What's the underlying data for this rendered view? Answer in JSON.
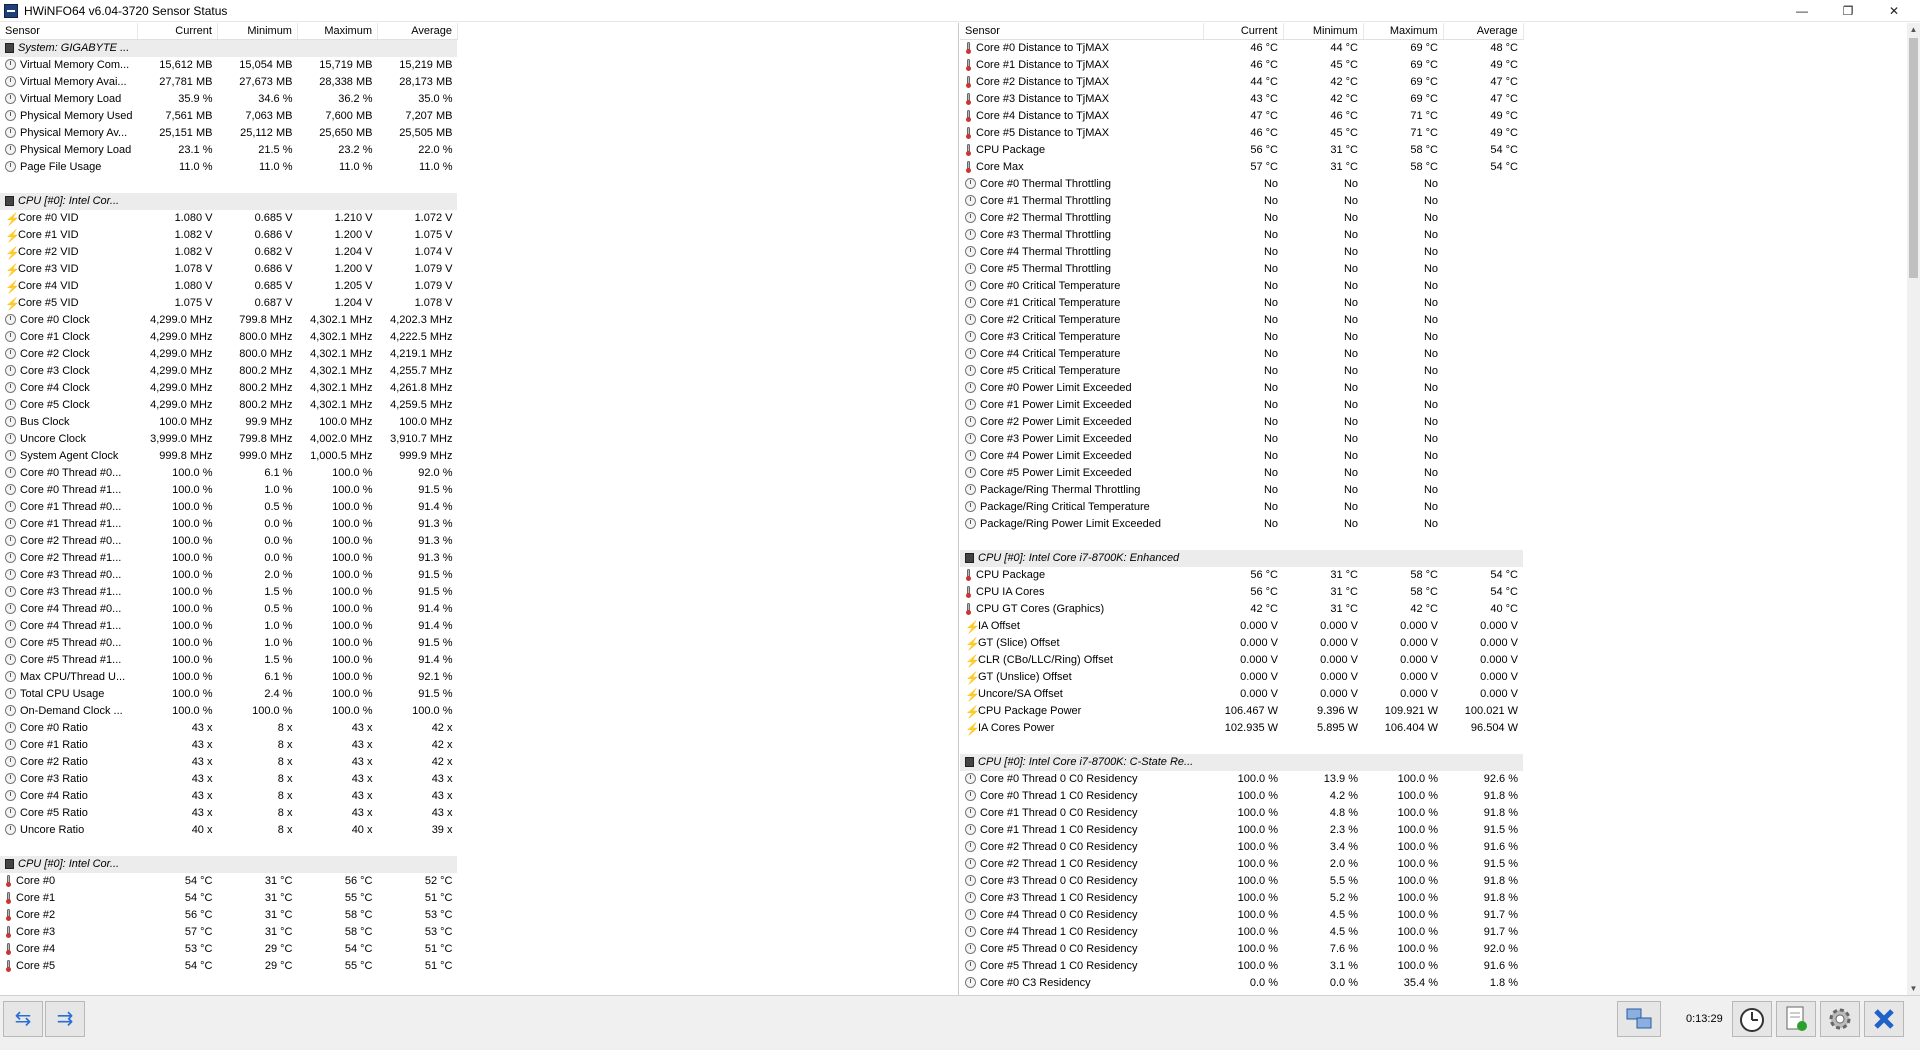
{
  "window": {
    "title": "HWiNFO64 v6.04-3720 Sensor Status",
    "minimize": "—",
    "restore": "❐",
    "close": "✕"
  },
  "columns": {
    "sensor": "Sensor",
    "current": "Current",
    "minimum": "Minimum",
    "maximum": "Maximum",
    "average": "Average"
  },
  "left_rows": [
    {
      "t": "group",
      "n": "System: GIGABYTE ..."
    },
    {
      "i": "clock",
      "n": "Virtual Memory Com...",
      "c": "15,612 MB",
      "mn": "15,054 MB",
      "mx": "15,719 MB",
      "a": "15,219 MB"
    },
    {
      "i": "clock",
      "n": "Virtual Memory Avai...",
      "c": "27,781 MB",
      "mn": "27,673 MB",
      "mx": "28,338 MB",
      "a": "28,173 MB"
    },
    {
      "i": "clock",
      "n": "Virtual Memory Load",
      "c": "35.9 %",
      "mn": "34.6 %",
      "mx": "36.2 %",
      "a": "35.0 %"
    },
    {
      "i": "clock",
      "n": "Physical Memory Used",
      "c": "7,561 MB",
      "mn": "7,063 MB",
      "mx": "7,600 MB",
      "a": "7,207 MB"
    },
    {
      "i": "clock",
      "n": "Physical Memory Av...",
      "c": "25,151 MB",
      "mn": "25,112 MB",
      "mx": "25,650 MB",
      "a": "25,505 MB"
    },
    {
      "i": "clock",
      "n": "Physical Memory Load",
      "c": "23.1 %",
      "mn": "21.5 %",
      "mx": "23.2 %",
      "a": "22.0 %"
    },
    {
      "i": "clock",
      "n": "Page File Usage",
      "c": "11.0 %",
      "mn": "11.0 %",
      "mx": "11.0 %",
      "a": "11.0 %"
    },
    {
      "t": "blank"
    },
    {
      "t": "group",
      "n": "CPU [#0]: Intel Cor..."
    },
    {
      "i": "bolt",
      "n": "Core #0 VID",
      "c": "1.080 V",
      "mn": "0.685 V",
      "mx": "1.210 V",
      "a": "1.072 V"
    },
    {
      "i": "bolt",
      "n": "Core #1 VID",
      "c": "1.082 V",
      "mn": "0.686 V",
      "mx": "1.200 V",
      "a": "1.075 V"
    },
    {
      "i": "bolt",
      "n": "Core #2 VID",
      "c": "1.082 V",
      "mn": "0.682 V",
      "mx": "1.204 V",
      "a": "1.074 V"
    },
    {
      "i": "bolt",
      "n": "Core #3 VID",
      "c": "1.078 V",
      "mn": "0.686 V",
      "mx": "1.200 V",
      "a": "1.079 V"
    },
    {
      "i": "bolt",
      "n": "Core #4 VID",
      "c": "1.080 V",
      "mn": "0.685 V",
      "mx": "1.205 V",
      "a": "1.079 V"
    },
    {
      "i": "bolt",
      "n": "Core #5 VID",
      "c": "1.075 V",
      "mn": "0.687 V",
      "mx": "1.204 V",
      "a": "1.078 V"
    },
    {
      "i": "clock",
      "n": "Core #0 Clock",
      "c": "4,299.0 MHz",
      "mn": "799.8 MHz",
      "mx": "4,302.1 MHz",
      "a": "4,202.3 MHz"
    },
    {
      "i": "clock",
      "n": "Core #1 Clock",
      "c": "4,299.0 MHz",
      "mn": "800.0 MHz",
      "mx": "4,302.1 MHz",
      "a": "4,222.5 MHz"
    },
    {
      "i": "clock",
      "n": "Core #2 Clock",
      "c": "4,299.0 MHz",
      "mn": "800.0 MHz",
      "mx": "4,302.1 MHz",
      "a": "4,219.1 MHz"
    },
    {
      "i": "clock",
      "n": "Core #3 Clock",
      "c": "4,299.0 MHz",
      "mn": "800.2 MHz",
      "mx": "4,302.1 MHz",
      "a": "4,255.7 MHz"
    },
    {
      "i": "clock",
      "n": "Core #4 Clock",
      "c": "4,299.0 MHz",
      "mn": "800.2 MHz",
      "mx": "4,302.1 MHz",
      "a": "4,261.8 MHz"
    },
    {
      "i": "clock",
      "n": "Core #5 Clock",
      "c": "4,299.0 MHz",
      "mn": "800.2 MHz",
      "mx": "4,302.1 MHz",
      "a": "4,259.5 MHz"
    },
    {
      "i": "clock",
      "n": "Bus Clock",
      "c": "100.0 MHz",
      "mn": "99.9 MHz",
      "mx": "100.0 MHz",
      "a": "100.0 MHz"
    },
    {
      "i": "clock",
      "n": "Uncore Clock",
      "c": "3,999.0 MHz",
      "mn": "799.8 MHz",
      "mx": "4,002.0 MHz",
      "a": "3,910.7 MHz"
    },
    {
      "i": "clock",
      "n": "System Agent Clock",
      "c": "999.8 MHz",
      "mn": "999.0 MHz",
      "mx": "1,000.5 MHz",
      "a": "999.9 MHz"
    },
    {
      "i": "clock",
      "n": "Core #0 Thread #0...",
      "c": "100.0 %",
      "mn": "6.1 %",
      "mx": "100.0 %",
      "a": "92.0 %"
    },
    {
      "i": "clock",
      "n": "Core #0 Thread #1...",
      "c": "100.0 %",
      "mn": "1.0 %",
      "mx": "100.0 %",
      "a": "91.5 %"
    },
    {
      "i": "clock",
      "n": "Core #1 Thread #0...",
      "c": "100.0 %",
      "mn": "0.5 %",
      "mx": "100.0 %",
      "a": "91.4 %"
    },
    {
      "i": "clock",
      "n": "Core #1 Thread #1...",
      "c": "100.0 %",
      "mn": "0.0 %",
      "mx": "100.0 %",
      "a": "91.3 %"
    },
    {
      "i": "clock",
      "n": "Core #2 Thread #0...",
      "c": "100.0 %",
      "mn": "0.0 %",
      "mx": "100.0 %",
      "a": "91.3 %"
    },
    {
      "i": "clock",
      "n": "Core #2 Thread #1...",
      "c": "100.0 %",
      "mn": "0.0 %",
      "mx": "100.0 %",
      "a": "91.3 %"
    },
    {
      "i": "clock",
      "n": "Core #3 Thread #0...",
      "c": "100.0 %",
      "mn": "2.0 %",
      "mx": "100.0 %",
      "a": "91.5 %"
    },
    {
      "i": "clock",
      "n": "Core #3 Thread #1...",
      "c": "100.0 %",
      "mn": "1.5 %",
      "mx": "100.0 %",
      "a": "91.5 %"
    },
    {
      "i": "clock",
      "n": "Core #4 Thread #0...",
      "c": "100.0 %",
      "mn": "0.5 %",
      "mx": "100.0 %",
      "a": "91.4 %"
    },
    {
      "i": "clock",
      "n": "Core #4 Thread #1...",
      "c": "100.0 %",
      "mn": "1.0 %",
      "mx": "100.0 %",
      "a": "91.4 %"
    },
    {
      "i": "clock",
      "n": "Core #5 Thread #0...",
      "c": "100.0 %",
      "mn": "1.0 %",
      "mx": "100.0 %",
      "a": "91.5 %"
    },
    {
      "i": "clock",
      "n": "Core #5 Thread #1...",
      "c": "100.0 %",
      "mn": "1.5 %",
      "mx": "100.0 %",
      "a": "91.4 %"
    },
    {
      "i": "clock",
      "n": "Max CPU/Thread U...",
      "c": "100.0 %",
      "mn": "6.1 %",
      "mx": "100.0 %",
      "a": "92.1 %"
    },
    {
      "i": "clock",
      "n": "Total CPU Usage",
      "c": "100.0 %",
      "mn": "2.4 %",
      "mx": "100.0 %",
      "a": "91.5 %"
    },
    {
      "i": "clock",
      "n": "On-Demand Clock ...",
      "c": "100.0 %",
      "mn": "100.0 %",
      "mx": "100.0 %",
      "a": "100.0 %"
    },
    {
      "i": "clock",
      "n": "Core #0 Ratio",
      "c": "43 x",
      "mn": "8 x",
      "mx": "43 x",
      "a": "42 x"
    },
    {
      "i": "clock",
      "n": "Core #1 Ratio",
      "c": "43 x",
      "mn": "8 x",
      "mx": "43 x",
      "a": "42 x"
    },
    {
      "i": "clock",
      "n": "Core #2 Ratio",
      "c": "43 x",
      "mn": "8 x",
      "mx": "43 x",
      "a": "42 x"
    },
    {
      "i": "clock",
      "n": "Core #3 Ratio",
      "c": "43 x",
      "mn": "8 x",
      "mx": "43 x",
      "a": "43 x"
    },
    {
      "i": "clock",
      "n": "Core #4 Ratio",
      "c": "43 x",
      "mn": "8 x",
      "mx": "43 x",
      "a": "43 x"
    },
    {
      "i": "clock",
      "n": "Core #5 Ratio",
      "c": "43 x",
      "mn": "8 x",
      "mx": "43 x",
      "a": "43 x"
    },
    {
      "i": "clock",
      "n": "Uncore Ratio",
      "c": "40 x",
      "mn": "8 x",
      "mx": "40 x",
      "a": "39 x"
    },
    {
      "t": "blank"
    },
    {
      "t": "group",
      "n": "CPU [#0]: Intel Cor..."
    },
    {
      "i": "therm",
      "n": "Core #0",
      "c": "54 °C",
      "mn": "31 °C",
      "mx": "56 °C",
      "a": "52 °C"
    },
    {
      "i": "therm",
      "n": "Core #1",
      "c": "54 °C",
      "mn": "31 °C",
      "mx": "55 °C",
      "a": "51 °C"
    },
    {
      "i": "therm",
      "n": "Core #2",
      "c": "56 °C",
      "mn": "31 °C",
      "mx": "58 °C",
      "a": "53 °C"
    },
    {
      "i": "therm",
      "n": "Core #3",
      "c": "57 °C",
      "mn": "31 °C",
      "mx": "58 °C",
      "a": "53 °C"
    },
    {
      "i": "therm",
      "n": "Core #4",
      "c": "53 °C",
      "mn": "29 °C",
      "mx": "54 °C",
      "a": "51 °C"
    },
    {
      "i": "therm",
      "n": "Core #5",
      "c": "54 °C",
      "mn": "29 °C",
      "mx": "55 °C",
      "a": "51 °C"
    }
  ],
  "right_rows": [
    {
      "i": "therm",
      "n": "Core #0 Distance to TjMAX",
      "c": "46 °C",
      "mn": "44 °C",
      "mx": "69 °C",
      "a": "48 °C"
    },
    {
      "i": "therm",
      "n": "Core #1 Distance to TjMAX",
      "c": "46 °C",
      "mn": "45 °C",
      "mx": "69 °C",
      "a": "49 °C"
    },
    {
      "i": "therm",
      "n": "Core #2 Distance to TjMAX",
      "c": "44 °C",
      "mn": "42 °C",
      "mx": "69 °C",
      "a": "47 °C"
    },
    {
      "i": "therm",
      "n": "Core #3 Distance to TjMAX",
      "c": "43 °C",
      "mn": "42 °C",
      "mx": "69 °C",
      "a": "47 °C"
    },
    {
      "i": "therm",
      "n": "Core #4 Distance to TjMAX",
      "c": "47 °C",
      "mn": "46 °C",
      "mx": "71 °C",
      "a": "49 °C"
    },
    {
      "i": "therm",
      "n": "Core #5 Distance to TjMAX",
      "c": "46 °C",
      "mn": "45 °C",
      "mx": "71 °C",
      "a": "49 °C"
    },
    {
      "i": "therm",
      "n": "CPU Package",
      "c": "56 °C",
      "mn": "31 °C",
      "mx": "58 °C",
      "a": "54 °C"
    },
    {
      "i": "therm",
      "n": "Core Max",
      "c": "57 °C",
      "mn": "31 °C",
      "mx": "58 °C",
      "a": "54 °C"
    },
    {
      "i": "clock",
      "n": "Core #0 Thermal Throttling",
      "c": "No",
      "mn": "No",
      "mx": "No",
      "a": ""
    },
    {
      "i": "clock",
      "n": "Core #1 Thermal Throttling",
      "c": "No",
      "mn": "No",
      "mx": "No",
      "a": ""
    },
    {
      "i": "clock",
      "n": "Core #2 Thermal Throttling",
      "c": "No",
      "mn": "No",
      "mx": "No",
      "a": ""
    },
    {
      "i": "clock",
      "n": "Core #3 Thermal Throttling",
      "c": "No",
      "mn": "No",
      "mx": "No",
      "a": ""
    },
    {
      "i": "clock",
      "n": "Core #4 Thermal Throttling",
      "c": "No",
      "mn": "No",
      "mx": "No",
      "a": ""
    },
    {
      "i": "clock",
      "n": "Core #5 Thermal Throttling",
      "c": "No",
      "mn": "No",
      "mx": "No",
      "a": ""
    },
    {
      "i": "clock",
      "n": "Core #0 Critical Temperature",
      "c": "No",
      "mn": "No",
      "mx": "No",
      "a": ""
    },
    {
      "i": "clock",
      "n": "Core #1 Critical Temperature",
      "c": "No",
      "mn": "No",
      "mx": "No",
      "a": ""
    },
    {
      "i": "clock",
      "n": "Core #2 Critical Temperature",
      "c": "No",
      "mn": "No",
      "mx": "No",
      "a": ""
    },
    {
      "i": "clock",
      "n": "Core #3 Critical Temperature",
      "c": "No",
      "mn": "No",
      "mx": "No",
      "a": ""
    },
    {
      "i": "clock",
      "n": "Core #4 Critical Temperature",
      "c": "No",
      "mn": "No",
      "mx": "No",
      "a": ""
    },
    {
      "i": "clock",
      "n": "Core #5 Critical Temperature",
      "c": "No",
      "mn": "No",
      "mx": "No",
      "a": ""
    },
    {
      "i": "clock",
      "n": "Core #0 Power Limit Exceeded",
      "c": "No",
      "mn": "No",
      "mx": "No",
      "a": ""
    },
    {
      "i": "clock",
      "n": "Core #1 Power Limit Exceeded",
      "c": "No",
      "mn": "No",
      "mx": "No",
      "a": ""
    },
    {
      "i": "clock",
      "n": "Core #2 Power Limit Exceeded",
      "c": "No",
      "mn": "No",
      "mx": "No",
      "a": ""
    },
    {
      "i": "clock",
      "n": "Core #3 Power Limit Exceeded",
      "c": "No",
      "mn": "No",
      "mx": "No",
      "a": ""
    },
    {
      "i": "clock",
      "n": "Core #4 Power Limit Exceeded",
      "c": "No",
      "mn": "No",
      "mx": "No",
      "a": ""
    },
    {
      "i": "clock",
      "n": "Core #5 Power Limit Exceeded",
      "c": "No",
      "mn": "No",
      "mx": "No",
      "a": ""
    },
    {
      "i": "clock",
      "n": "Package/Ring Thermal Throttling",
      "c": "No",
      "mn": "No",
      "mx": "No",
      "a": ""
    },
    {
      "i": "clock",
      "n": "Package/Ring Critical Temperature",
      "c": "No",
      "mn": "No",
      "mx": "No",
      "a": ""
    },
    {
      "i": "clock",
      "n": "Package/Ring Power Limit Exceeded",
      "c": "No",
      "mn": "No",
      "mx": "No",
      "a": ""
    },
    {
      "t": "blank"
    },
    {
      "t": "group",
      "n": "CPU [#0]: Intel Core i7-8700K: Enhanced"
    },
    {
      "i": "therm",
      "n": "CPU Package",
      "c": "56 °C",
      "mn": "31 °C",
      "mx": "58 °C",
      "a": "54 °C"
    },
    {
      "i": "therm",
      "n": "CPU IA Cores",
      "c": "56 °C",
      "mn": "31 °C",
      "mx": "58 °C",
      "a": "54 °C"
    },
    {
      "i": "therm",
      "n": "CPU GT Cores (Graphics)",
      "c": "42 °C",
      "mn": "31 °C",
      "mx": "42 °C",
      "a": "40 °C"
    },
    {
      "i": "bolt",
      "n": "IA Offset",
      "c": "0.000 V",
      "mn": "0.000 V",
      "mx": "0.000 V",
      "a": "0.000 V"
    },
    {
      "i": "bolt",
      "n": "GT (Slice) Offset",
      "c": "0.000 V",
      "mn": "0.000 V",
      "mx": "0.000 V",
      "a": "0.000 V"
    },
    {
      "i": "bolt",
      "n": "CLR (CBo/LLC/Ring) Offset",
      "c": "0.000 V",
      "mn": "0.000 V",
      "mx": "0.000 V",
      "a": "0.000 V"
    },
    {
      "i": "bolt",
      "n": "GT (Unslice) Offset",
      "c": "0.000 V",
      "mn": "0.000 V",
      "mx": "0.000 V",
      "a": "0.000 V"
    },
    {
      "i": "bolt",
      "n": "Uncore/SA Offset",
      "c": "0.000 V",
      "mn": "0.000 V",
      "mx": "0.000 V",
      "a": "0.000 V"
    },
    {
      "i": "bolt",
      "n": "CPU Package Power",
      "c": "106.467 W",
      "mn": "9.396 W",
      "mx": "109.921 W",
      "a": "100.021 W"
    },
    {
      "i": "bolt",
      "n": "IA Cores Power",
      "c": "102.935 W",
      "mn": "5.895 W",
      "mx": "106.404 W",
      "a": "96.504 W"
    },
    {
      "t": "blank"
    },
    {
      "t": "group",
      "n": "CPU [#0]: Intel Core i7-8700K: C-State Re..."
    },
    {
      "i": "clock",
      "n": "Core #0 Thread 0 C0 Residency",
      "c": "100.0 %",
      "mn": "13.9 %",
      "mx": "100.0 %",
      "a": "92.6 %"
    },
    {
      "i": "clock",
      "n": "Core #0 Thread 1 C0 Residency",
      "c": "100.0 %",
      "mn": "4.2 %",
      "mx": "100.0 %",
      "a": "91.8 %"
    },
    {
      "i": "clock",
      "n": "Core #1 Thread 0 C0 Residency",
      "c": "100.0 %",
      "mn": "4.8 %",
      "mx": "100.0 %",
      "a": "91.8 %"
    },
    {
      "i": "clock",
      "n": "Core #1 Thread 1 C0 Residency",
      "c": "100.0 %",
      "mn": "2.3 %",
      "mx": "100.0 %",
      "a": "91.5 %"
    },
    {
      "i": "clock",
      "n": "Core #2 Thread 0 C0 Residency",
      "c": "100.0 %",
      "mn": "3.4 %",
      "mx": "100.0 %",
      "a": "91.6 %"
    },
    {
      "i": "clock",
      "n": "Core #2 Thread 1 C0 Residency",
      "c": "100.0 %",
      "mn": "2.0 %",
      "mx": "100.0 %",
      "a": "91.5 %"
    },
    {
      "i": "clock",
      "n": "Core #3 Thread 0 C0 Residency",
      "c": "100.0 %",
      "mn": "5.5 %",
      "mx": "100.0 %",
      "a": "91.8 %"
    },
    {
      "i": "clock",
      "n": "Core #3 Thread 1 C0 Residency",
      "c": "100.0 %",
      "mn": "5.2 %",
      "mx": "100.0 %",
      "a": "91.8 %"
    },
    {
      "i": "clock",
      "n": "Core #4 Thread 0 C0 Residency",
      "c": "100.0 %",
      "mn": "4.5 %",
      "mx": "100.0 %",
      "a": "91.7 %"
    },
    {
      "i": "clock",
      "n": "Core #4 Thread 1 C0 Residency",
      "c": "100.0 %",
      "mn": "4.5 %",
      "mx": "100.0 %",
      "a": "91.7 %"
    },
    {
      "i": "clock",
      "n": "Core #5 Thread 0 C0 Residency",
      "c": "100.0 %",
      "mn": "7.6 %",
      "mx": "100.0 %",
      "a": "92.0 %"
    },
    {
      "i": "clock",
      "n": "Core #5 Thread 1 C0 Residency",
      "c": "100.0 %",
      "mn": "3.1 %",
      "mx": "100.0 %",
      "a": "91.6 %"
    },
    {
      "i": "clock",
      "n": "Core #0 C3 Residency",
      "c": "0.0 %",
      "mn": "0.0 %",
      "mx": "35.4 %",
      "a": "1.8 %"
    }
  ],
  "footer": {
    "elapsed_time": "0:13:29"
  },
  "icons": {
    "nav_left": "⇆",
    "nav_right": "⇉",
    "network": "network-icon",
    "clock": "stopwatch-icon",
    "report": "report-icon",
    "settings": "gear-icon",
    "close": "close-icon"
  },
  "colors": {
    "group_bg": "#ececec",
    "bolt": "#e4a400",
    "accent": "#2a6fd6"
  }
}
